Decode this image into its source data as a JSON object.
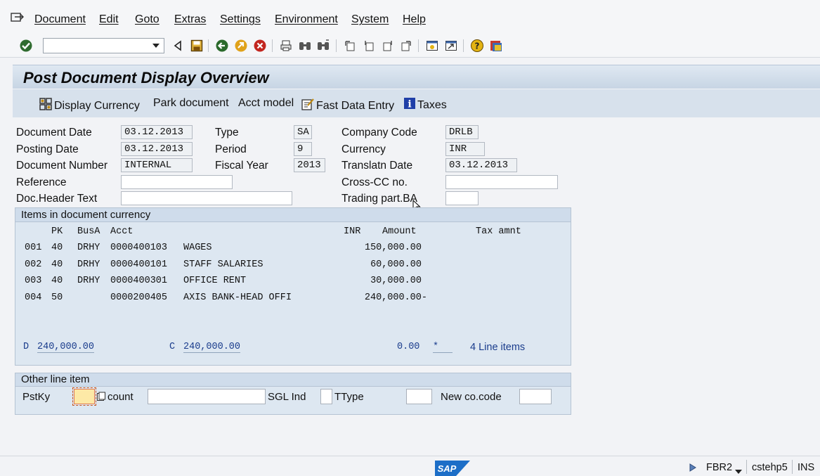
{
  "menu": {
    "items": [
      "Document",
      "Edit",
      "Goto",
      "Extras",
      "Settings",
      "Environment",
      "System",
      "Help"
    ]
  },
  "toolbar": {
    "command_value": "",
    "icons": [
      "enter-icon",
      "back-icon",
      "save-icon",
      "back-arrow-icon",
      "exit-icon",
      "cancel-icon",
      "print-icon",
      "find-icon",
      "find-next-icon",
      "first-page-icon",
      "previous-page-icon",
      "next-page-icon",
      "last-page-icon",
      "create-session-icon",
      "shortcut-icon",
      "help-icon",
      "customize-layout-icon"
    ]
  },
  "title": "Post Document Display Overview",
  "app_toolbar": {
    "display_currency": "Display Currency",
    "park_document": "Park document",
    "acct_model": "Acct model",
    "fast_data_entry": "Fast Data Entry",
    "taxes": "Taxes"
  },
  "header": {
    "document_date_label": "Document Date",
    "document_date": "03.12.2013",
    "posting_date_label": "Posting Date",
    "posting_date": "03.12.2013",
    "document_number_label": "Document Number",
    "document_number": "INTERNAL",
    "reference_label": "Reference",
    "reference": "",
    "doc_header_text_label": "Doc.Header Text",
    "doc_header_text": "",
    "type_label": "Type",
    "type": "SA",
    "period_label": "Period",
    "period": "9",
    "fiscal_year_label": "Fiscal Year",
    "fiscal_year": "2013",
    "company_code_label": "Company Code",
    "company_code": "DRLB",
    "currency_label": "Currency",
    "currency": "INR",
    "translatn_date_label": "Translatn Date",
    "translatn_date": "03.12.2013",
    "cross_cc_label": "Cross-CC no.",
    "cross_cc": "",
    "trading_part_label": "Trading part.BA",
    "trading_part": ""
  },
  "items": {
    "title": "Items in document currency",
    "columns": {
      "pk": "PK",
      "busa": "BusA",
      "acct": "Acct",
      "curr": "INR",
      "amount": "Amount",
      "tax": "Tax amnt"
    },
    "rows": [
      {
        "no": "001",
        "pk": "40",
        "busa": "DRHY",
        "acct": "0000400103",
        "text": "WAGES",
        "amount": "150,000.00"
      },
      {
        "no": "002",
        "pk": "40",
        "busa": "DRHY",
        "acct": "0000400101",
        "text": "STAFF SALARIES",
        "amount": "60,000.00"
      },
      {
        "no": "003",
        "pk": "40",
        "busa": "DRHY",
        "acct": "0000400301",
        "text": "OFFICE RENT",
        "amount": "30,000.00"
      },
      {
        "no": "004",
        "pk": "50",
        "busa": "",
        "acct": "0000200405",
        "text": "AXIS BANK-HEAD OFFI",
        "amount": "240,000.00-"
      }
    ],
    "totals": {
      "debit_prefix": "D",
      "debit": "240,000.00",
      "credit_prefix": "C",
      "credit": "240,000.00",
      "balance": "0.00",
      "marker": "*",
      "line_items": "4 Line items"
    }
  },
  "other_line_item": {
    "title": "Other line item",
    "pstky_label": "PstKy",
    "pstky": "",
    "account_label": "count",
    "account": "",
    "sgl_ind_label": "SGL Ind",
    "sgl_ind": "",
    "ttype_label": "TType",
    "ttype": "",
    "new_co_code_label": "New co.code",
    "new_co_code": ""
  },
  "status": {
    "transaction": "FBR2",
    "server": "cstehp5",
    "mode": "INS",
    "logo": "SAP"
  },
  "colors": {
    "title_bar": "#c7d5e4",
    "group_bg": "#dde7f1",
    "totals_text": "#1a3c8c",
    "highlight_field": "#fde9a6"
  }
}
